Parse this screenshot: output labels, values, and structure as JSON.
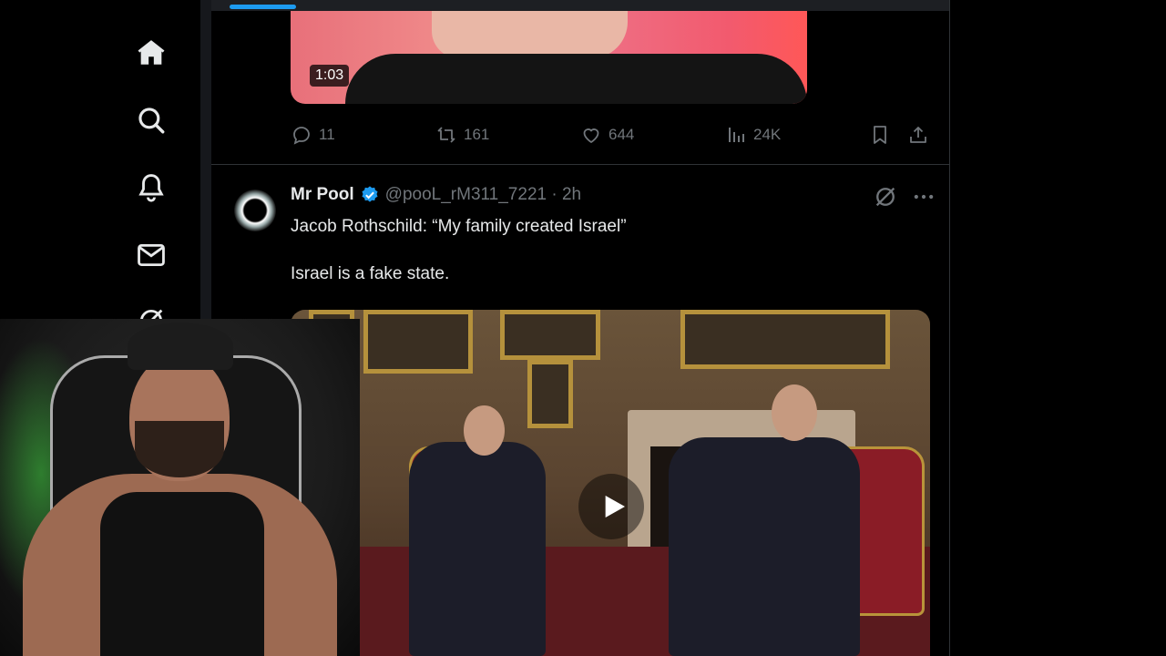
{
  "nav": {
    "items": [
      {
        "name": "home",
        "icon": "home-icon"
      },
      {
        "name": "explore",
        "icon": "search-icon"
      },
      {
        "name": "notifications",
        "icon": "bell-icon"
      },
      {
        "name": "messages",
        "icon": "mail-icon"
      },
      {
        "name": "grok",
        "icon": "grok-icon"
      }
    ]
  },
  "video_progress": 0.09,
  "previous_post": {
    "video_duration": "1:03",
    "actions": {
      "replies": "11",
      "reposts": "161",
      "likes": "644",
      "views": "24K"
    }
  },
  "post": {
    "author_name": "Mr Pool",
    "handle_time": "@pooL_rM311_7221 · 2h",
    "verified": true,
    "text": "Jacob Rothschild: “My family created Israel”\n\nIsrael is a fake state.",
    "media_type": "video"
  },
  "colors": {
    "accent": "#1d9bf0",
    "muted": "#71767b",
    "text": "#e7e9ea",
    "background": "#000000"
  }
}
